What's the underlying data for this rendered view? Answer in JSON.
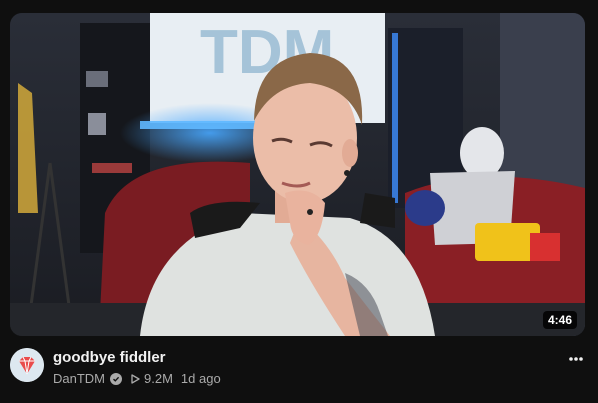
{
  "video": {
    "title": "goodbye fiddler",
    "duration": "4:46",
    "channel": "DanTDM",
    "views": "9.2M",
    "published": "1d ago"
  },
  "icons": {
    "verified": "verified-check-icon",
    "views": "play-triangle-icon",
    "more": "more-vert-icon",
    "avatar": "diamond-avatar"
  },
  "colors": {
    "background": "#0f0f0f",
    "title": "#f1f1f1",
    "secondary_text": "#aaaaaa",
    "avatar_diamond": "#e94b4b"
  }
}
